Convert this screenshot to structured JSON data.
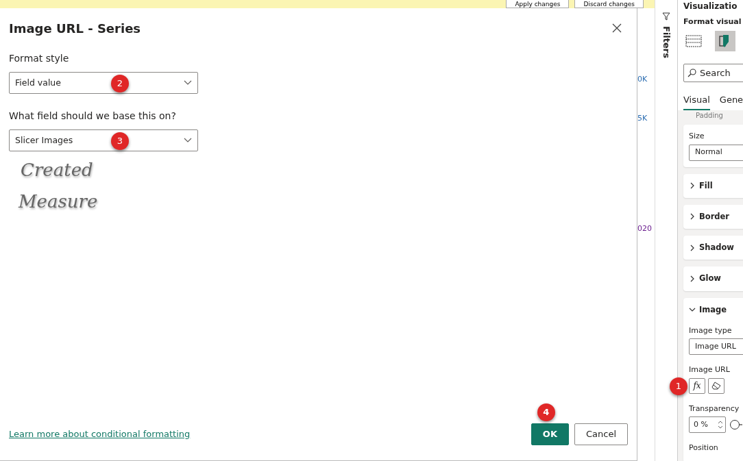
{
  "top_bar": {
    "buttons": [
      "Apply changes",
      "Discard changes"
    ]
  },
  "dialog": {
    "title": "Image URL - Series",
    "fields": [
      {
        "label": "Format style",
        "value": "Field value",
        "badge": "2"
      },
      {
        "label": "What field should we base this on?",
        "value": "Slicer Images",
        "badge": "3"
      }
    ],
    "annotation": [
      "Created",
      "Measure"
    ],
    "link": "Learn more about conditional formatting",
    "buttons": [
      {
        "label": "OK",
        "kind": "primary",
        "badge": "4"
      },
      {
        "label": "Cancel",
        "kind": "secondary"
      }
    ]
  },
  "canvas": {
    "axis_labels": [
      "0K",
      "5K",
      "020"
    ]
  },
  "filters_pane": {
    "title": "Filters"
  },
  "format_pane": {
    "title": "Visualizatio",
    "subtitle": "Format visual",
    "view_buttons": [
      {
        "selected": false
      },
      {
        "selected": true
      }
    ],
    "search": {
      "placeholder": "Search"
    },
    "tabs": [
      {
        "label": "Visual",
        "selected": true
      },
      {
        "label": "Gene",
        "selected": false
      }
    ],
    "partial_label": "Padding",
    "size": {
      "label": "Size",
      "value": "Normal"
    },
    "sections": [
      {
        "label": "Fill",
        "expanded": false
      },
      {
        "label": "Border",
        "expanded": false
      },
      {
        "label": "Shadow",
        "expanded": false
      },
      {
        "label": "Glow",
        "expanded": false
      },
      {
        "label": "Image",
        "expanded": true,
        "rows": [
          {
            "kind": "dropdown",
            "label": "Image type",
            "value": "Image URL"
          },
          {
            "kind": "fx",
            "label": "Image URL",
            "button": "fx",
            "badge": "1"
          },
          {
            "kind": "spinner",
            "label": "Transparency",
            "value": "0 %"
          },
          {
            "kind": "label",
            "label": "Position"
          }
        ]
      }
    ]
  }
}
